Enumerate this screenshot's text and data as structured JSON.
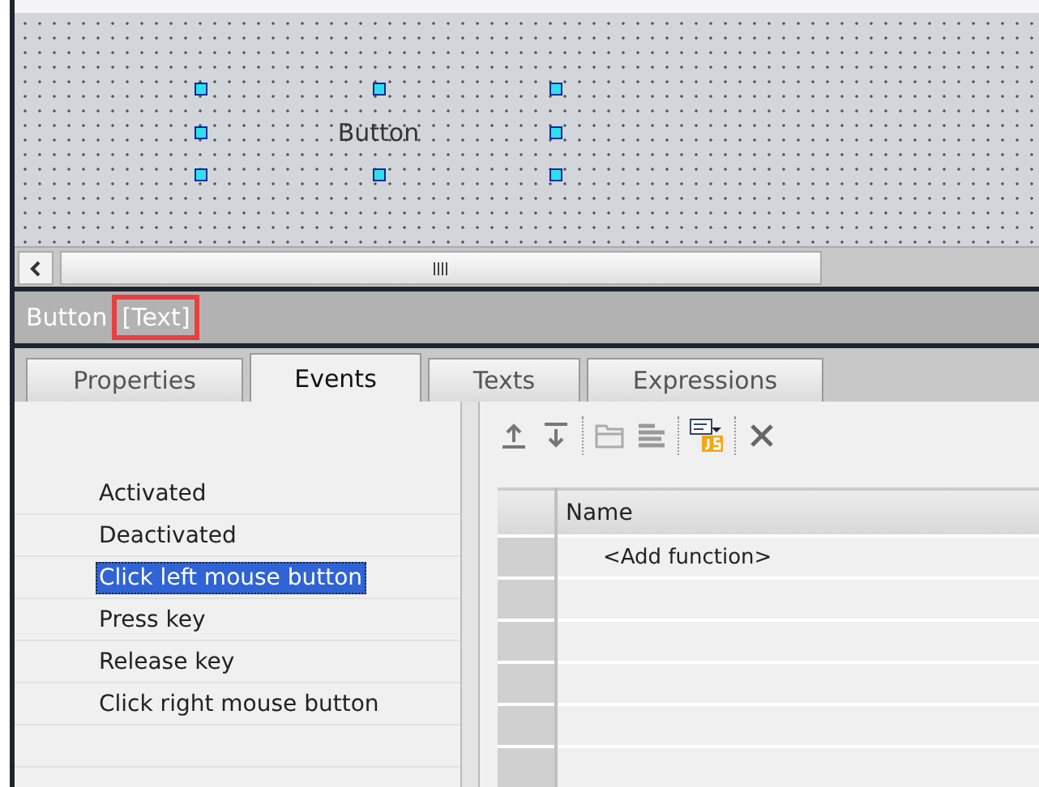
{
  "canvas": {
    "button_label": "Button",
    "selected": true
  },
  "inspector_title": {
    "object": "Button",
    "property": "[Text]",
    "highlighted": true
  },
  "tabs": [
    {
      "label": "Properties",
      "selected": false
    },
    {
      "label": "Events",
      "selected": true
    },
    {
      "label": "Texts",
      "selected": false
    },
    {
      "label": "Expressions",
      "selected": false
    }
  ],
  "events": [
    {
      "label": "Activated",
      "selected": false
    },
    {
      "label": "Deactivated",
      "selected": false
    },
    {
      "label": "Click left mouse button",
      "selected": true
    },
    {
      "label": "Press key",
      "selected": false
    },
    {
      "label": "Release key",
      "selected": false
    },
    {
      "label": "Click right mouse button",
      "selected": false
    }
  ],
  "table": {
    "columns": [
      "Name"
    ],
    "rows": [
      {
        "name": "<Add function>"
      }
    ]
  }
}
